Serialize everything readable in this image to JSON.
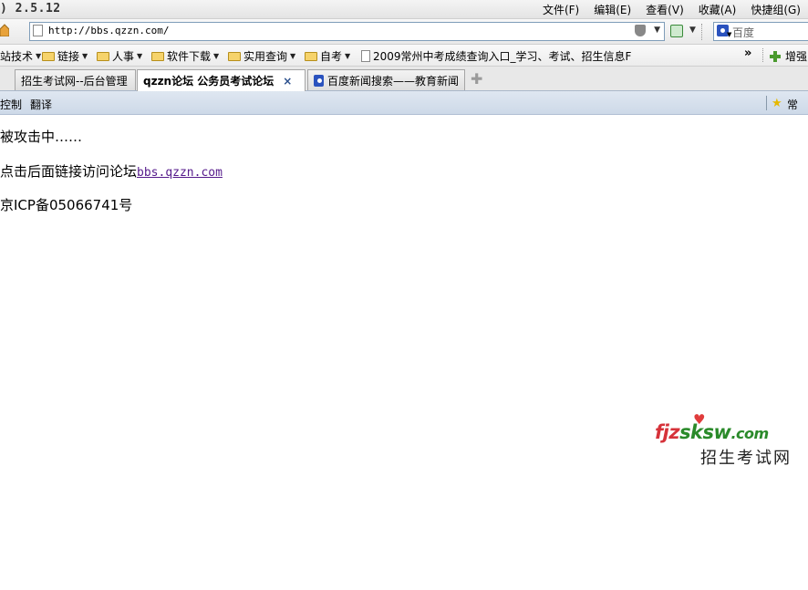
{
  "window": {
    "version": ") 2.5.12"
  },
  "menu": [
    "文件(F)",
    "编辑(E)",
    "查看(V)",
    "收藏(A)",
    "快捷组(G)"
  ],
  "address": {
    "url": "http://bbs.qzzn.com/"
  },
  "search": {
    "placeholder": "百度"
  },
  "bookmarks": [
    {
      "label": "站技术",
      "icon": "folder-icon",
      "dropdown": true
    },
    {
      "label": "链接",
      "icon": "folder-icon",
      "dropdown": true
    },
    {
      "label": "人事",
      "icon": "folder-icon",
      "dropdown": true
    },
    {
      "label": "软件下载",
      "icon": "folder-icon",
      "dropdown": true
    },
    {
      "label": "实用查询",
      "icon": "folder-icon",
      "dropdown": true
    },
    {
      "label": "自考",
      "icon": "folder-icon",
      "dropdown": true
    },
    {
      "label": "2009常州中考成绩查询入口_学习、考试、招生信息F",
      "icon": "page-icon",
      "dropdown": false
    }
  ],
  "bookmarks_extra": {
    "more": "»",
    "enhance": "增强"
  },
  "tabs": [
    {
      "label": "招生考试网--后台管理",
      "active": false
    },
    {
      "label": "qzzn论坛 公务员考试论坛",
      "active": true,
      "close": "×"
    },
    {
      "label": "百度新闻搜索——教育新闻",
      "active": false,
      "icon": "baidu-paw-icon"
    }
  ],
  "toolstrip": {
    "control": "控制",
    "translate": "翻译",
    "favorites": "常用"
  },
  "content": {
    "line1": "被攻击中……",
    "line2_prefix": "点击后面链接访问论坛",
    "line2_link": "bbs.qzzn.com",
    "line3": "京ICP备05066741号"
  },
  "watermark": {
    "logo_a": "fjz",
    "logo_b": "sksw",
    "logo_c": ".com",
    "sub": "招生考试网"
  }
}
